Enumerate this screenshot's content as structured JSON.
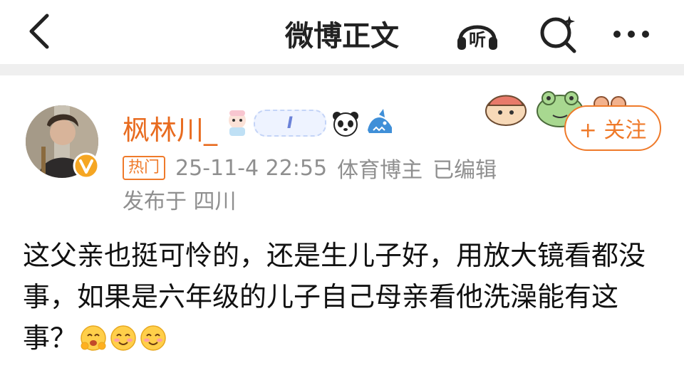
{
  "header": {
    "title": "微博正文",
    "listen_icon_label": "听"
  },
  "post": {
    "author": {
      "name": "枫林川_",
      "badge_text": "I"
    },
    "meta": {
      "hot_tag": "热门",
      "timestamp": "25-11-4 22:55",
      "category": "体育博主",
      "edited": "已编辑",
      "location": "发布于 四川"
    },
    "follow_label": "+ 关注",
    "content": "这父亲也挺可怜的，还是生儿子好，用放大镜看都没事，如果是六年级的儿子自己母亲看他洗澡能有这事？"
  },
  "colors": {
    "accent": "#ef7a2a",
    "username": "#e86b1f",
    "meta_text": "#8f8f8f",
    "divider": "#efefef"
  },
  "icons": {
    "back": "chevron-left-icon",
    "listen": "headphone-listen-icon",
    "search": "search-sparkle-icon",
    "more": "more-dots-icon",
    "verified": "verified-v-badge-icon"
  }
}
